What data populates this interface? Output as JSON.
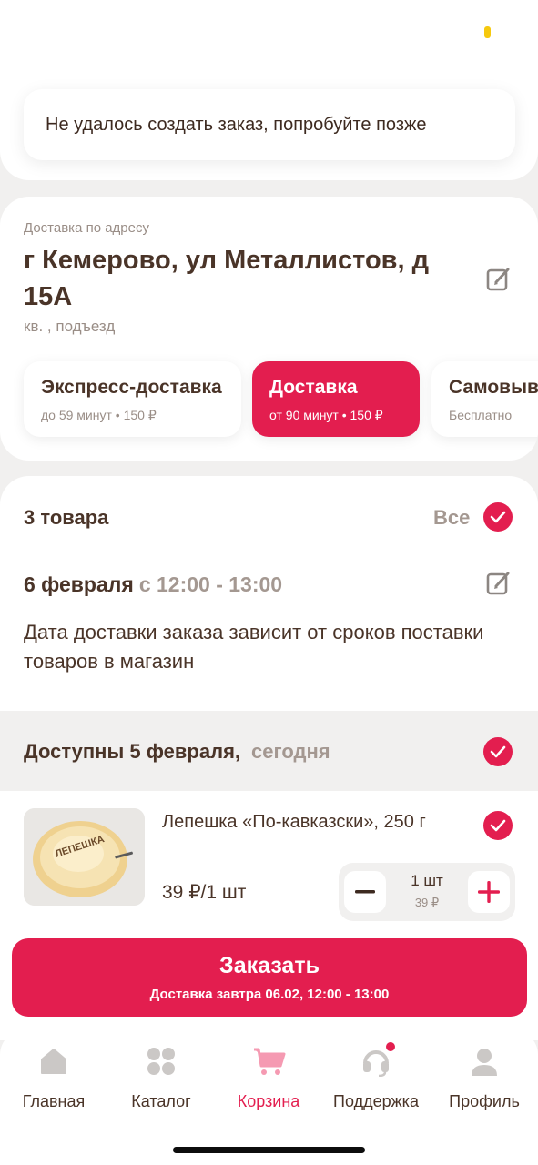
{
  "toast": {
    "message": "Не удалось создать заказ, попробуйте позже"
  },
  "address": {
    "label": "Доставка по адресу",
    "line": "г Кемерово, ул Металлистов, д 15А",
    "details": "кв. , подъезд"
  },
  "delivery_options": [
    {
      "title": "Экспресс-доставка",
      "subtitle": "до 59 минут • 150 ₽",
      "selected": false
    },
    {
      "title": "Доставка",
      "subtitle": "от 90 минут • 150 ₽",
      "selected": true
    },
    {
      "title": "Самовывоз",
      "subtitle": "Бесплатно",
      "selected": false
    }
  ],
  "cart": {
    "items_count": "3 товара",
    "select_all_label": "Все",
    "delivery_date": "6 февраля",
    "delivery_time": "с 12:00 - 13:00",
    "notice": "Дата доставки заказа зависит от сроков поставки товаров в магазин",
    "available_label": "Доступны 5 февраля,",
    "available_suffix": "сегодня"
  },
  "product": {
    "name": "Лепешка «По-кавказски», 250 г",
    "price": "39 ₽/1 шт",
    "quantity": "1 шт",
    "quantity_total": "39 ₽",
    "package_text": "ЛЕПЕШКА"
  },
  "order_button": {
    "label": "Заказать",
    "sublabel": "Доставка завтра 06.02, 12:00 - 13:00"
  },
  "tabs": [
    {
      "label": "Главная",
      "icon": "home-icon",
      "active": false
    },
    {
      "label": "Каталог",
      "icon": "catalog-icon",
      "active": false
    },
    {
      "label": "Корзина",
      "icon": "cart-icon",
      "active": true
    },
    {
      "label": "Поддержка",
      "icon": "support-icon",
      "active": false
    },
    {
      "label": "Профиль",
      "icon": "profile-icon",
      "active": false
    }
  ],
  "colors": {
    "accent": "#e31e4f",
    "text": "#4a3428",
    "muted": "#9a8e87",
    "background": "#f1f0ef"
  }
}
